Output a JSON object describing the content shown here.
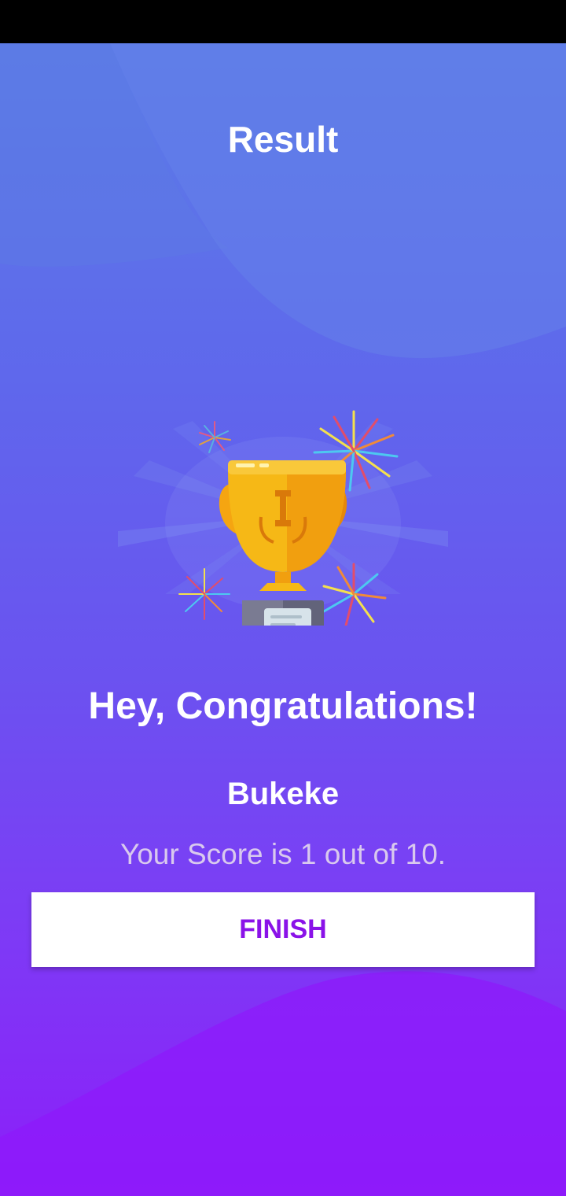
{
  "result_screen": {
    "title": "Result",
    "trophy_icon": "trophy-icon",
    "congrats_text": "Hey, Congratulations!",
    "user_name": "Bukeke",
    "score_text": "Your Score is 1 out of 10.",
    "finish_button_label": "FINISH"
  },
  "colors": {
    "gradient_top": "#5b7de6",
    "gradient_bottom": "#8c1ef9",
    "button_text": "#8a12e8",
    "score_text": "#d9c9ee"
  }
}
